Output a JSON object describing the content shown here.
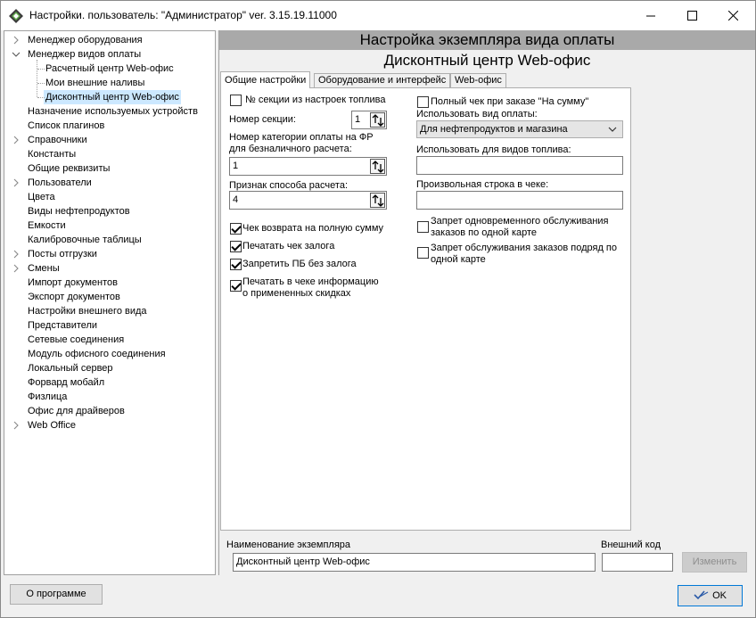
{
  "window": {
    "title": "Настройки. пользователь: \"Администратор\" ver. 3.15.19.11000",
    "minimize": "—",
    "maximize": "☐",
    "close": "✕"
  },
  "tree": {
    "items": [
      {
        "label": "Менеджер оборудования",
        "expander": "›",
        "level": 0
      },
      {
        "label": "Менеджер видов оплаты",
        "expander": "⌄",
        "level": 0
      },
      {
        "label": "Расчетный центр Web-офис",
        "expander": "",
        "level": 1
      },
      {
        "label": "Мои внешние наливы",
        "expander": "",
        "level": 1
      },
      {
        "label": "Дисконтный центр Web-офис",
        "expander": "",
        "level": 1,
        "selected": true
      },
      {
        "label": "Назначение используемых устройств",
        "expander": "",
        "level": 0
      },
      {
        "label": "Список плагинов",
        "expander": "",
        "level": 0
      },
      {
        "label": "Справочники",
        "expander": "›",
        "level": 0
      },
      {
        "label": "Константы",
        "expander": "",
        "level": 0
      },
      {
        "label": "Общие реквизиты",
        "expander": "",
        "level": 0
      },
      {
        "label": "Пользователи",
        "expander": "›",
        "level": 0
      },
      {
        "label": "Цвета",
        "expander": "",
        "level": 0
      },
      {
        "label": "Виды нефтепродуктов",
        "expander": "",
        "level": 0
      },
      {
        "label": "Емкости",
        "expander": "",
        "level": 0
      },
      {
        "label": "Калибровочные таблицы",
        "expander": "",
        "level": 0
      },
      {
        "label": "Посты отгрузки",
        "expander": "›",
        "level": 0
      },
      {
        "label": "Смены",
        "expander": "›",
        "level": 0
      },
      {
        "label": "Импорт документов",
        "expander": "",
        "level": 0
      },
      {
        "label": "Экспорт документов",
        "expander": "",
        "level": 0
      },
      {
        "label": "Настройки внешнего вида",
        "expander": "",
        "level": 0
      },
      {
        "label": "Представители",
        "expander": "",
        "level": 0
      },
      {
        "label": "Сетевые соединения",
        "expander": "",
        "level": 0
      },
      {
        "label": "Модуль офисного соединения",
        "expander": "",
        "level": 0
      },
      {
        "label": "Локальный сервер",
        "expander": "",
        "level": 0
      },
      {
        "label": "Форвард мобайл",
        "expander": "",
        "level": 0
      },
      {
        "label": "Физлица",
        "expander": "",
        "level": 0
      },
      {
        "label": "Офис для драйверов",
        "expander": "",
        "level": 0
      },
      {
        "label": "Web Office",
        "expander": "›",
        "level": 0
      }
    ]
  },
  "header": {
    "title": "Настройка экземпляра вида оплаты",
    "subtitle": "Дисконтный центр Web-офис"
  },
  "tabs": [
    {
      "label": "Общие настройки",
      "active": true
    },
    {
      "label": "Оборудование и интерфейс",
      "active": false
    },
    {
      "label": "Web-офис",
      "active": false
    }
  ],
  "general": {
    "section_from_fuel_label": "№ секции из настроек топлива",
    "section_from_fuel_checked": false,
    "section_number_label": "Номер секции:",
    "section_number_value": "1",
    "payment_category_label": "Номер категории оплаты на ФР\nдля безналичного расчета:",
    "payment_category_value": "1",
    "payment_method_label": "Признак способа расчета:",
    "payment_method_value": "4",
    "return_full_label": "Чек возврата на полную сумму",
    "return_full_checked": true,
    "print_deposit_label": "Печатать чек залога",
    "print_deposit_checked": true,
    "forbid_pb_label": "Запретить ПБ без залога",
    "forbid_pb_checked": true,
    "print_discount_label": "Печатать в чеке информацию\nо примененных скидках",
    "print_discount_checked": true,
    "full_check_label": "Полный чек при заказе \"На сумму\"",
    "full_check_checked": false,
    "use_payment_type_label": "Использовать вид оплаты:",
    "use_payment_type_value": "Для нефтепродуктов и магазина",
    "use_for_fuel_label": "Использовать для видов топлива:",
    "use_for_fuel_value": "",
    "custom_string_label": "Произвольная строка в чеке:",
    "custom_string_value": "",
    "forbid_simultaneous_label": "Запрет одновременного обслуживания\nзаказов по одной карте",
    "forbid_simultaneous_checked": false,
    "forbid_consecutive_label": "Запрет обслуживания заказов подряд по\nодной карте",
    "forbid_consecutive_checked": false
  },
  "instance": {
    "name_label": "Наименование экземпляра",
    "name_value": "Дисконтный центр Web-офис",
    "external_code_label": "Внешний код",
    "external_code_value": "",
    "change_button": "Изменить"
  },
  "footer": {
    "about_button": "О программе",
    "ok_button": "OK"
  }
}
